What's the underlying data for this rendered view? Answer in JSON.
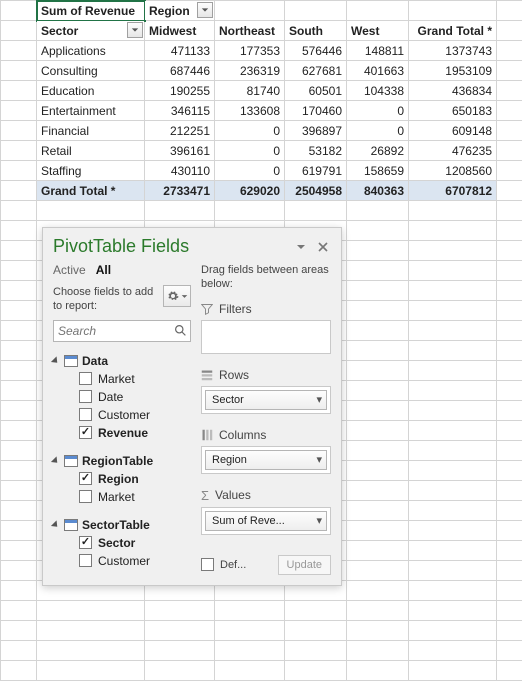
{
  "pivot": {
    "measure_label": "Sum of Revenue",
    "col_field_label": "Region",
    "row_field_label": "Sector",
    "col_headers": [
      "Midwest",
      "Northeast",
      "South",
      "West",
      "Grand Total *"
    ],
    "rows": [
      {
        "label": "Applications",
        "vals": [
          "471133",
          "177353",
          "576446",
          "148811",
          "1373743"
        ]
      },
      {
        "label": "Consulting",
        "vals": [
          "687446",
          "236319",
          "627681",
          "401663",
          "1953109"
        ]
      },
      {
        "label": "Education",
        "vals": [
          "190255",
          "81740",
          "60501",
          "104338",
          "436834"
        ]
      },
      {
        "label": "Entertainment",
        "vals": [
          "346115",
          "133608",
          "170460",
          "0",
          "650183"
        ]
      },
      {
        "label": "Financial",
        "vals": [
          "212251",
          "0",
          "396897",
          "0",
          "609148"
        ]
      },
      {
        "label": "Retail",
        "vals": [
          "396161",
          "0",
          "53182",
          "26892",
          "476235"
        ]
      },
      {
        "label": "Staffing",
        "vals": [
          "430110",
          "0",
          "619791",
          "158659",
          "1208560"
        ]
      }
    ],
    "grand_row_label": "Grand Total *",
    "grand_vals": [
      "2733471",
      "629020",
      "2504958",
      "840363",
      "6707812"
    ]
  },
  "pane": {
    "title": "PivotTable Fields",
    "tab_active": "Active",
    "tab_all": "All",
    "choose_label": "Choose fields to add to report:",
    "search_placeholder": "Search",
    "drag_hint": "Drag fields between areas below:",
    "tables": [
      {
        "name": "Data",
        "fields": [
          {
            "label": "Market",
            "checked": false
          },
          {
            "label": "Date",
            "checked": false
          },
          {
            "label": "Customer",
            "checked": false
          },
          {
            "label": "Revenue",
            "checked": true
          }
        ]
      },
      {
        "name": "RegionTable",
        "fields": [
          {
            "label": "Region",
            "checked": true
          },
          {
            "label": "Market",
            "checked": false
          }
        ]
      },
      {
        "name": "SectorTable",
        "fields": [
          {
            "label": "Sector",
            "checked": true
          },
          {
            "label": "Customer",
            "checked": false
          }
        ]
      }
    ],
    "area_filters": "Filters",
    "area_rows": "Rows",
    "area_columns": "Columns",
    "area_values": "Values",
    "rows_pill": "Sector",
    "columns_pill": "Region",
    "values_pill": "Sum of Reve...",
    "defer_label": "Def...",
    "update_label": "Update"
  }
}
